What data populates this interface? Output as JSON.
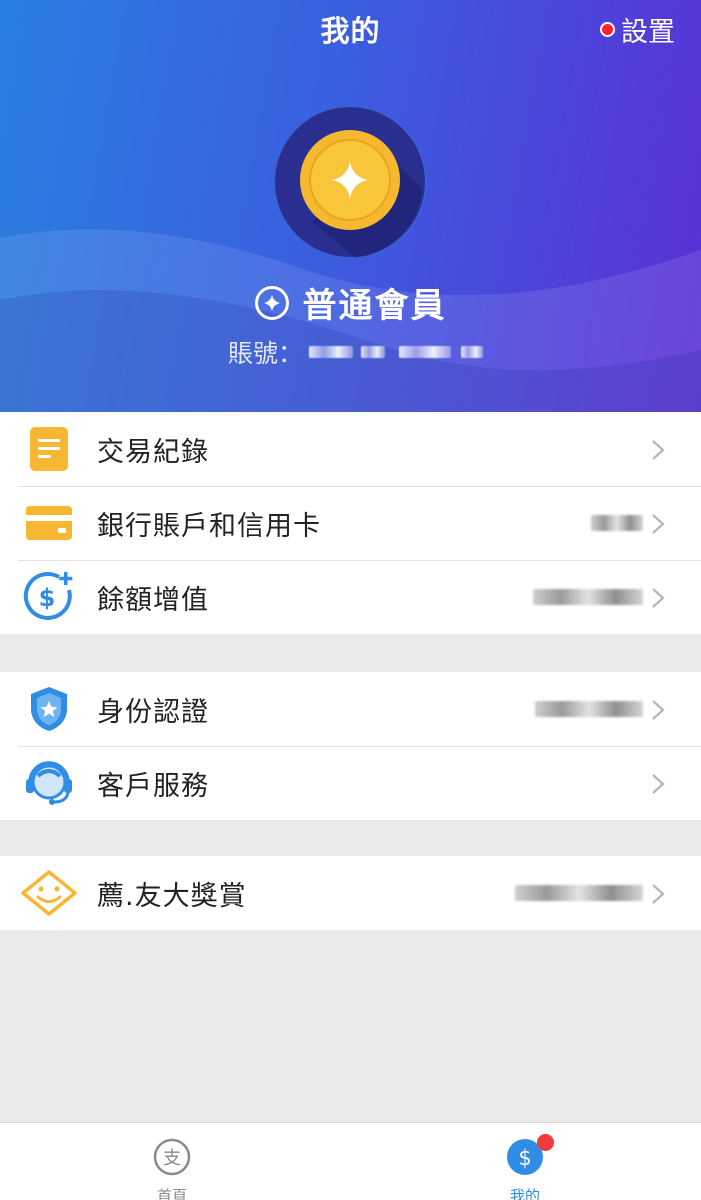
{
  "header": {
    "title": "我的",
    "settings_label": "設置",
    "member_level": "普通會員",
    "account_label": "賬號："
  },
  "menu_groups": [
    [
      {
        "label": "交易紀錄",
        "icon": "document-icon"
      },
      {
        "label": "銀行賬戶和信用卡",
        "icon": "card-icon"
      },
      {
        "label": "餘額增值",
        "icon": "dollar-plus-icon"
      }
    ],
    [
      {
        "label": "身份認證",
        "icon": "shield-star-icon"
      },
      {
        "label": "客戶服務",
        "icon": "headset-icon"
      }
    ],
    [
      {
        "label": "薦.友大獎賞",
        "icon": "smile-diamond-icon"
      }
    ]
  ],
  "tabbar": {
    "home_label": "首頁",
    "home_icon_glyph": "支",
    "mine_label": "我的",
    "mine_icon_glyph": "$"
  },
  "colors": {
    "header_start": "#2a7fe0",
    "header_end": "#5b2fd6",
    "icon_orange": "#f7b733",
    "icon_blue": "#2f8de6",
    "badge_red": "#f23b3b"
  }
}
